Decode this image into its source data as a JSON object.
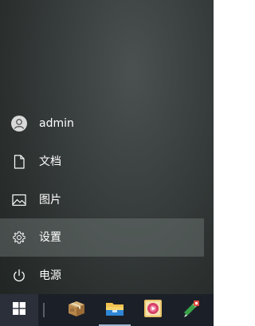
{
  "start_menu": {
    "items": [
      {
        "label": "admin",
        "icon": "user-avatar-icon"
      },
      {
        "label": "文档",
        "icon": "document-icon"
      },
      {
        "label": "图片",
        "icon": "picture-icon"
      },
      {
        "label": "设置",
        "icon": "gear-icon",
        "state": "hovered"
      },
      {
        "label": "电源",
        "icon": "power-icon"
      }
    ]
  },
  "taskbar": {
    "start_icon": "windows-logo-icon",
    "pinned": [
      {
        "name": "package-icon"
      },
      {
        "name": "file-explorer-icon",
        "running": true
      },
      {
        "name": "media-app-icon"
      },
      {
        "name": "tools-app-icon"
      }
    ]
  },
  "colors": {
    "taskbar": "#1b1f27",
    "hover_highlight": "#6b7270",
    "text": "#ffffff",
    "explorer_yellow": "#f2c14e",
    "explorer_blue": "#2f86d6"
  }
}
